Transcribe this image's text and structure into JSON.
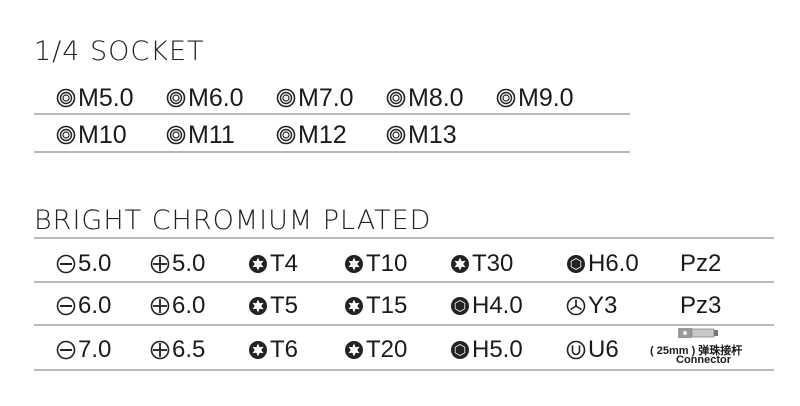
{
  "socket": {
    "title": "1/4 SOCKET",
    "rows": [
      [
        "M5.0",
        "M6.0",
        "M7.0",
        "M8.0",
        "M9.0"
      ],
      [
        "M10",
        "M11",
        "M12",
        "M13"
      ]
    ]
  },
  "plated": {
    "title": "BRIGHT CHROMIUM PLATED",
    "rows": [
      [
        {
          "icon": "slotted-icon",
          "text": "5.0"
        },
        {
          "icon": "phillips-icon",
          "text": "5.0"
        },
        {
          "icon": "torx-icon",
          "text": "T4"
        },
        {
          "icon": "torx-icon",
          "text": "T10"
        },
        {
          "icon": "torx-icon",
          "text": "T30"
        },
        {
          "icon": "hex-icon",
          "text": "H6.0"
        },
        {
          "icon": "",
          "text": "Pz2"
        }
      ],
      [
        {
          "icon": "slotted-icon",
          "text": "6.0"
        },
        {
          "icon": "phillips-icon",
          "text": "6.0"
        },
        {
          "icon": "torx-icon",
          "text": "T5"
        },
        {
          "icon": "torx-icon",
          "text": "T15"
        },
        {
          "icon": "hex-icon",
          "text": "H4.0"
        },
        {
          "icon": "triwing-icon",
          "text": "Y3"
        },
        {
          "icon": "",
          "text": "Pz3"
        }
      ],
      [
        {
          "icon": "slotted-icon",
          "text": "7.0"
        },
        {
          "icon": "phillips-icon",
          "text": "6.5"
        },
        {
          "icon": "torx-icon",
          "text": "T6"
        },
        {
          "icon": "torx-icon",
          "text": "T20"
        },
        {
          "icon": "hex-icon",
          "text": "H5.0"
        },
        {
          "icon": "u-icon",
          "text": "U6"
        }
      ]
    ],
    "connector": {
      "size": "( 25mm ) 弹珠接杆",
      "label": "Connector"
    }
  }
}
